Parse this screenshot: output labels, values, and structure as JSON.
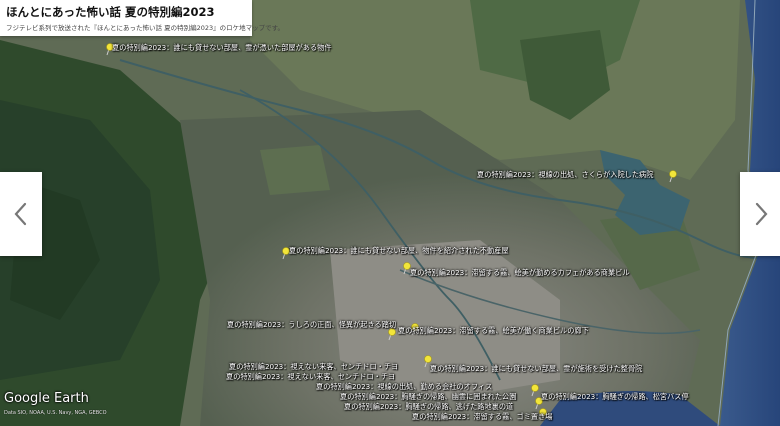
{
  "header": {
    "title": "ほんとにあった怖い話 夏の特別編2023",
    "subtitle": "フジテレビ系列で放送された『ほんとにあった怖い話 夏の特別編2023』のロケ地マップです。"
  },
  "nav": {
    "prev_icon": "chevron-left-icon",
    "next_icon": "chevron-right-icon"
  },
  "markers": [
    {
      "label": "夏の特別編2023：誰にも貸せない部屋、霊が憑いた部屋がある物件"
    },
    {
      "label": "夏の特別編2023：視線の出処、さくらが入院した病院"
    },
    {
      "label": "夏の特別編2023：誰にも貸せない部屋、物件を紹介された不動産屋"
    },
    {
      "label": "夏の特別編2023：滞留する霧、絵美が勤めるカフェがある商業ビル"
    },
    {
      "label": "夏の特別編2023：うしろの正面、怪異が起きる踏切"
    },
    {
      "label": "夏の特別編2023：滞留する霧、絵美が働く商業ビルの廊下"
    },
    {
      "label": "夏の特別編2023：視えない来客、センチドロ・チヨ"
    },
    {
      "label": "夏の特別編2023：誰にも貸せない部屋、霊が施術を受けた整骨院"
    },
    {
      "label": "夏の特別編2023：視えない来客、センチドロ・チヨ"
    },
    {
      "label": "夏の特別編2023：視線の出処、勤める会社のオフィス"
    },
    {
      "label": "夏の特別編2023：胸騒ぎの帰路、幽霊に囲まれた公園"
    },
    {
      "label": "夏の特別編2023：胸騒ぎの帰路、松宮バス停"
    },
    {
      "label": "夏の特別編2023：胸騒ぎの帰路、逃げた路地裏の道"
    },
    {
      "label": "夏の特別編2023：滞留する霧、ゴミ置き場"
    }
  ],
  "branding": {
    "logo": "Google Earth",
    "credit": "Data SIO, NOAA, U.S. Navy, NGA, GEBCO"
  },
  "colors": {
    "pin": "#f2e53a",
    "sea": "#2f4b7c",
    "forest": "#2f4a2c",
    "urban": "#7a7a72"
  }
}
